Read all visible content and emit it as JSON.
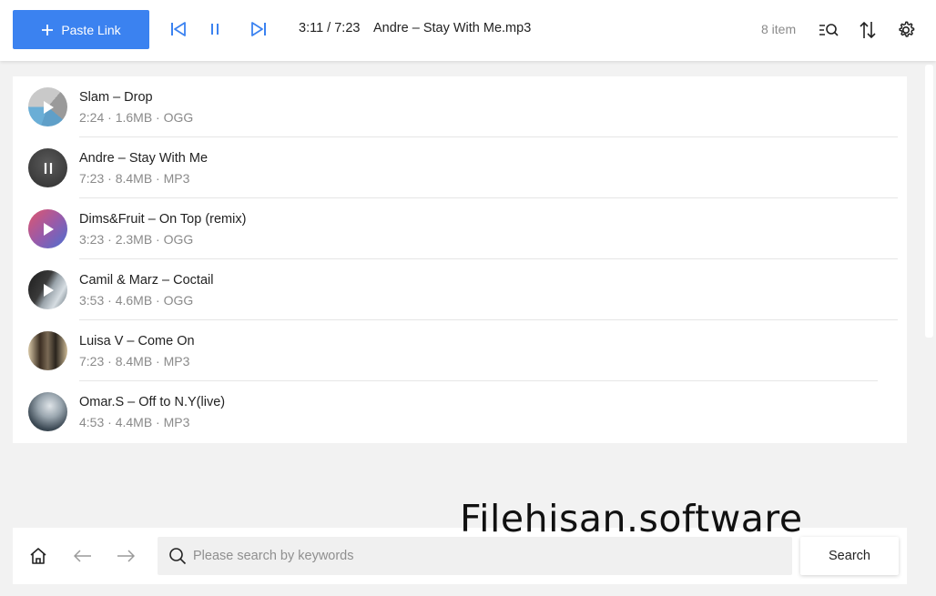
{
  "header": {
    "paste_button_label": "Paste Link",
    "now_playing_time": "3:11 / 7:23",
    "now_playing_title": "Andre – Stay With Me.mp3",
    "item_count": "8 item"
  },
  "icons": {
    "paste": "plus-icon",
    "previous": "skip-previous-icon",
    "pause": "pause-icon",
    "next": "skip-next-icon",
    "filter": "list-search-icon",
    "sort": "sort-icon",
    "settings": "gear-icon",
    "home": "home-icon",
    "back": "arrow-left-icon",
    "forward": "arrow-right-icon",
    "search": "search-icon"
  },
  "colors": {
    "accent": "#3b82f0",
    "muted_text": "#8a8a8a"
  },
  "tracks": [
    {
      "title": "Slam – Drop",
      "meta": "2:24 · 1.6MB · OGG",
      "state": "play"
    },
    {
      "title": "Andre – Stay With Me",
      "meta": "7:23 · 8.4MB · MP3",
      "state": "pause"
    },
    {
      "title": "Dims&Fruit – On Top (remix)",
      "meta": "3:23 · 2.3MB · OGG",
      "state": "play"
    },
    {
      "title": "Camil & Marz – Coctail",
      "meta": "3:53 · 4.6MB · OGG",
      "state": "play"
    },
    {
      "title": "Luisa V – Come On",
      "meta": "7:23 · 8.4MB · MP3",
      "state": "none"
    },
    {
      "title": "Omar.S – Off to N.Y(live)",
      "meta": "4:53 · 4.4MB · MP3",
      "state": "none"
    }
  ],
  "search": {
    "placeholder": "Please search by keywords",
    "value": "",
    "button_label": "Search"
  },
  "watermark": "Filehisan.software"
}
